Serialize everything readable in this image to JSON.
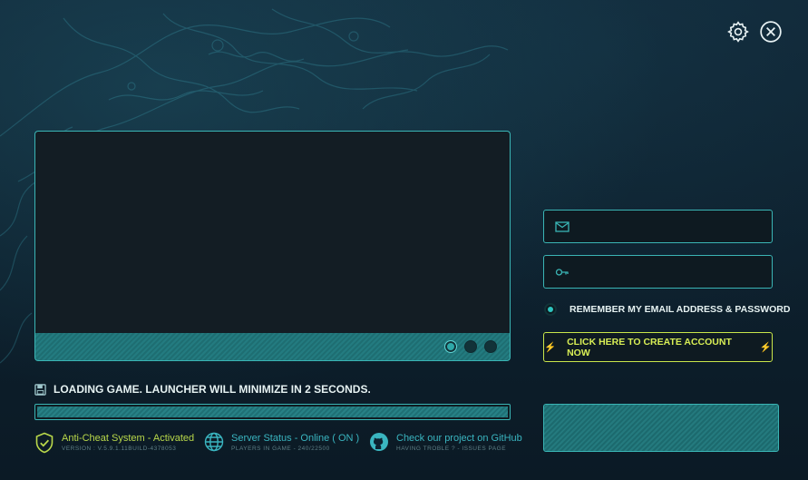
{
  "window": {
    "settings_icon": "gear-icon",
    "close_icon": "close-circle-icon"
  },
  "slideshow": {
    "dots_count": 3,
    "active_dot": 1
  },
  "status": {
    "icon": "floppy-disk-icon",
    "text": "LOADING GAME. LAUNCHER WILL MINIMIZE IN 2 SECONDS.",
    "progress": 1.0
  },
  "info": {
    "anticheat": {
      "icon": "shield-check-icon",
      "title": "Anti-Cheat System - Activated",
      "sub": "VERSION : V.5.9.1.11BUILD-4378053",
      "color": "#b9d84a"
    },
    "server": {
      "icon": "globe-icon",
      "title": "Server Status - Online ( ON )",
      "sub": "PLAYERS IN GAME - 240/22500",
      "color": "#3ab5c0"
    },
    "github": {
      "icon": "github-icon",
      "title": "Check our project on GitHub",
      "sub": "HAVING TROBLE ? - ISSUES PAGE",
      "color": "#3ab5c0"
    }
  },
  "login": {
    "email_icon": "envelope-icon",
    "email_value": "",
    "email_placeholder": "",
    "password_icon": "key-icon",
    "password_value": "",
    "password_placeholder": "",
    "remember_label": "REMEMBER MY EMAIL ADDRESS & PASSWORD",
    "remember_checked": true,
    "create_label": "CLICK HERE TO CREATE ACCOUNT NOW",
    "create_icon": "lightning-icon",
    "login_label": ""
  },
  "colors": {
    "accent": "#3ab5b5",
    "lime": "#c9e64a",
    "background": "#0d2130"
  }
}
